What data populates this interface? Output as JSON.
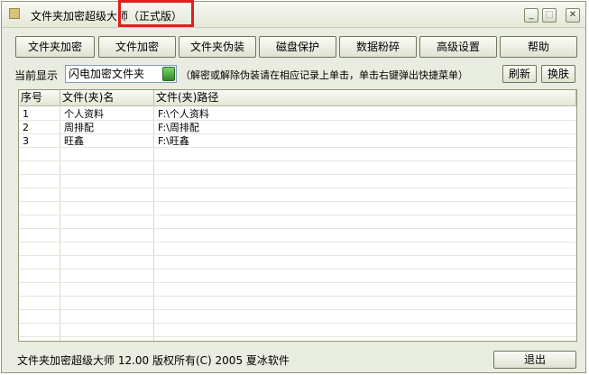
{
  "window": {
    "title": "文件夹加密超级大师（正式版）",
    "controls": [
      "minimize-icon",
      "maximize-icon",
      "close-icon"
    ],
    "highlight_color": "#e01e1e"
  },
  "toolbar": {
    "buttons": [
      "文件夹加密",
      "文件加密",
      "文件夹伪装",
      "磁盘保护",
      "数据粉碎",
      "高级设置",
      "帮助"
    ]
  },
  "filter": {
    "label": "当前显示",
    "selected": "闪电加密文件夹",
    "hint": "（解密或解除伪装请在相应记录上单击，单击右键弹出快捷菜单）",
    "refresh": "刷新",
    "switch": "换肤"
  },
  "table": {
    "headers": [
      "序号",
      "文件(夹)名",
      "文件(夹)路径"
    ],
    "rows": [
      [
        "1",
        "个人资料",
        "F:\\个人资料"
      ],
      [
        "2",
        "周排配",
        "F:\\周排配"
      ],
      [
        "3",
        "旺鑫",
        "F:\\旺鑫"
      ]
    ]
  },
  "footer": {
    "text": "文件夹加密超级大师 12.00  版权所有(C) 2005 夏冰软件",
    "exit": "退出"
  }
}
